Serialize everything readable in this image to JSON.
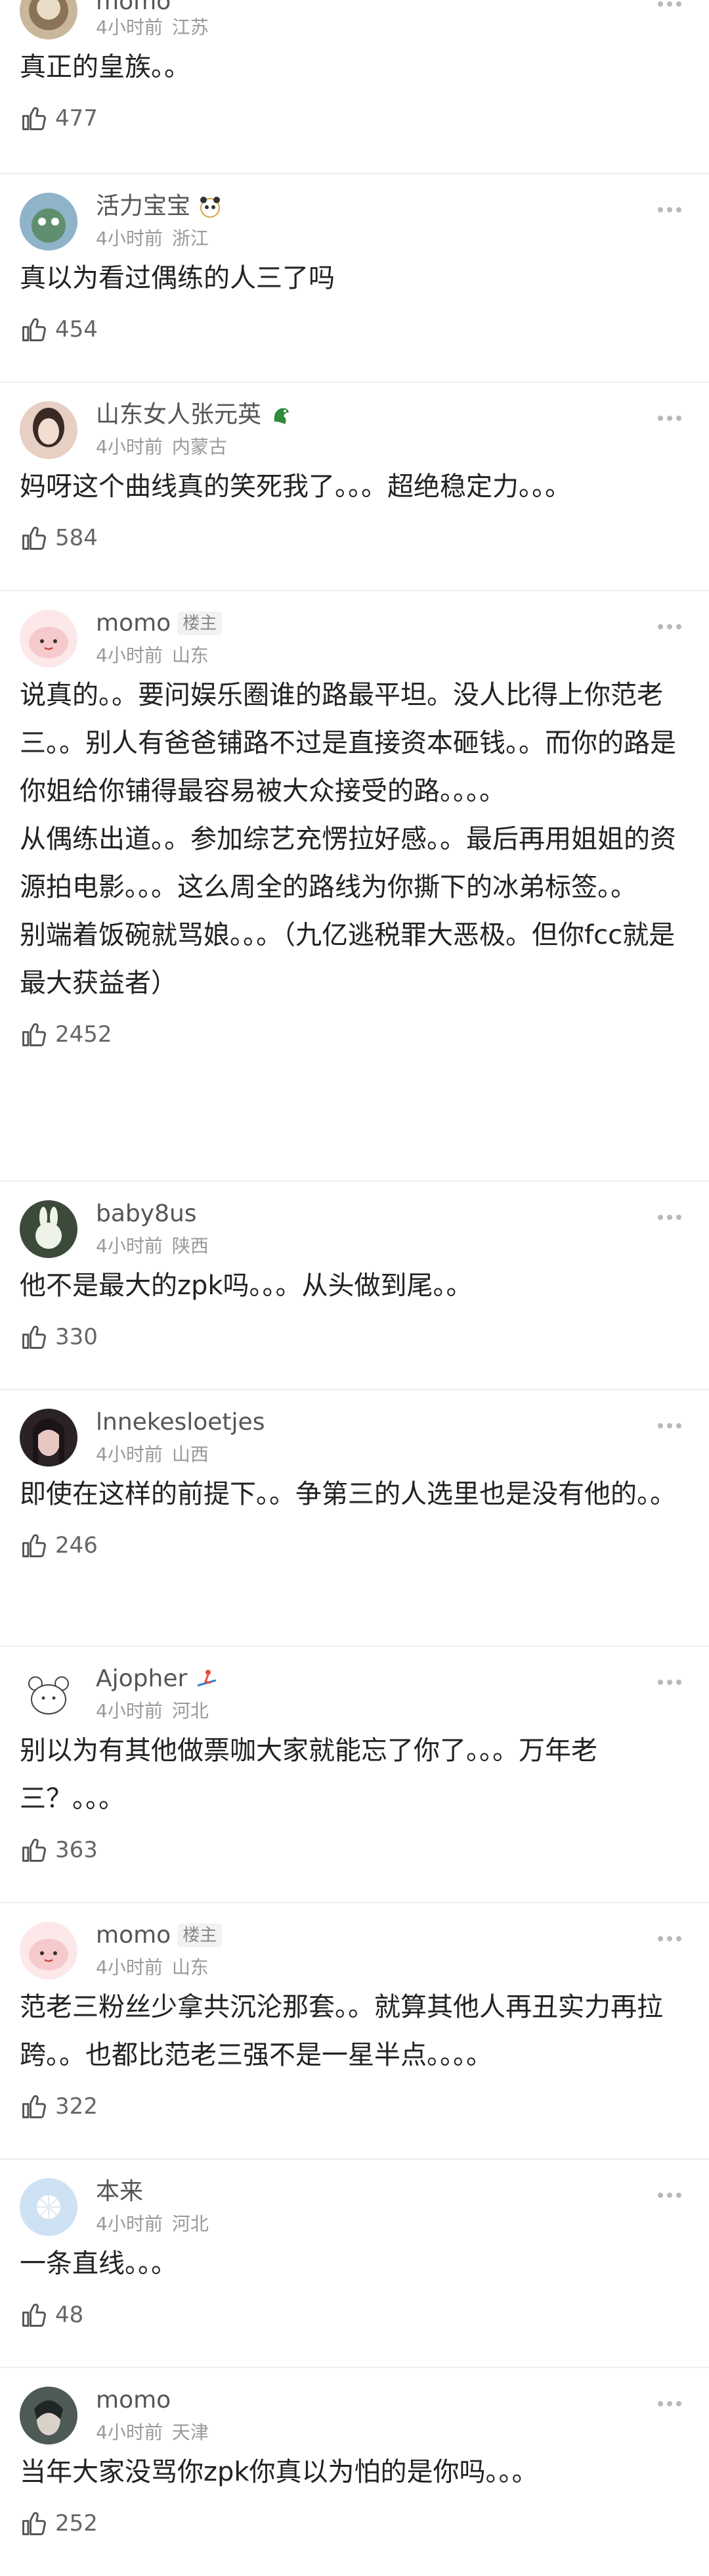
{
  "comments": [
    {
      "name": "momo",
      "op": "",
      "time": "4小时前",
      "loc": "江苏",
      "text": "真正的皇族。。",
      "likes": "477",
      "avatar_color": "#c9b79c",
      "medal": ""
    },
    {
      "name": "活力宝宝",
      "op": "",
      "time": "4小时前",
      "loc": "浙江",
      "text": "真以为看过偶练的人三了吗",
      "likes": "454",
      "avatar_color": "#8fb3c9",
      "medal": "panda-medal-icon"
    },
    {
      "name": "山东女人张元英",
      "op": "",
      "time": "4小时前",
      "loc": "内蒙古",
      "text": "妈呀这个曲线真的笑死我了。。。超绝稳定力。。。",
      "likes": "584",
      "avatar_color": "#e7cfc4",
      "medal": "dragon-medal-icon"
    },
    {
      "name": "momo",
      "op": "楼主",
      "time": "4小时前",
      "loc": "山东",
      "text": "说真的。。要问娱乐圈谁的路最平坦。没人比得上你范老三。。别人有爸爸铺路不过是直接资本砸钱。。而你的路是你姐给你铺得最容易被大众接受的路。。。。\n从偶练出道。。参加综艺充愣拉好感。。最后再用姐姐的资源拍电影。。。这么周全的路线为你撕下的冰弟标签。。\n别端着饭碗就骂娘。。。（九亿逃税罪大恶极。但你fcc就是最大获益者）",
      "likes": "2452",
      "avatar_color": "#f6c9cc",
      "medal": ""
    },
    {
      "name": "baby8us",
      "op": "",
      "time": "4小时前",
      "loc": "陕西",
      "text": "他不是最大的zpk吗。。。从头做到尾。。",
      "likes": "330",
      "avatar_color": "#3c4a3a",
      "medal": ""
    },
    {
      "name": "lnnekesloetjes",
      "op": "",
      "time": "4小时前",
      "loc": "山西",
      "text": "即使在这样的前提下。。争第三的人选里也是没有他的。。",
      "likes": "246",
      "avatar_color": "#2a2226",
      "medal": ""
    },
    {
      "name": "Ajopher",
      "op": "",
      "time": "4小时前",
      "loc": "河北",
      "text": "别以为有其他做票咖大家就能忘了你了。。。万年老三？。。。",
      "likes": "363",
      "avatar_color": "#ffffff",
      "medal": "skier-medal-icon"
    },
    {
      "name": "momo",
      "op": "楼主",
      "time": "4小时前",
      "loc": "山东",
      "text": "范老三粉丝少拿共沉沦那套。。就算其他人再丑实力再拉跨。。也都比范老三强不是一星半点。。。。",
      "likes": "322",
      "avatar_color": "#f6c9cc",
      "medal": ""
    },
    {
      "name": "本来",
      "op": "",
      "time": "4小时前",
      "loc": "河北",
      "text": "一条直线。。。",
      "likes": "48",
      "avatar_color": "#b9d3ea",
      "medal": ""
    },
    {
      "name": "momo",
      "op": "",
      "time": "4小时前",
      "loc": "天津",
      "text": "当年大家没骂你zpk你真以为怕的是你吗。。。",
      "likes": "252",
      "avatar_color": "#4d5a55",
      "medal": ""
    }
  ]
}
